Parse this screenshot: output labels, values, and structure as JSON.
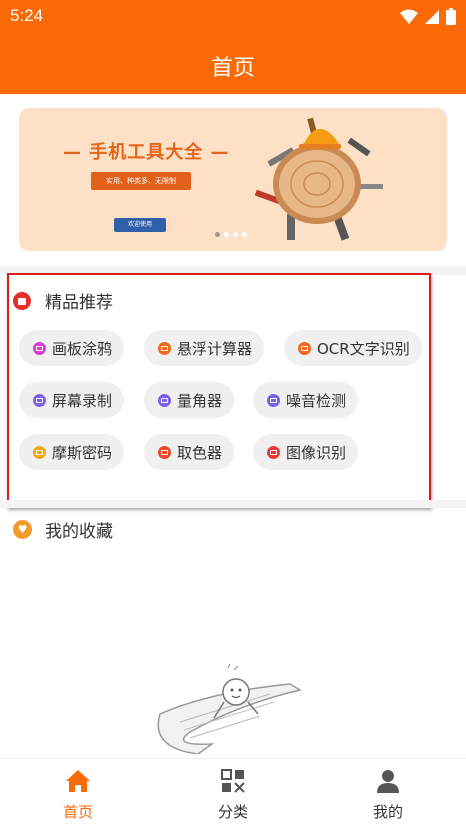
{
  "status_bar": {
    "time": "5:24"
  },
  "app_bar": {
    "title": "首页"
  },
  "banner": {
    "title": "— 手机工具大全 —",
    "subtitle": "实用、种类多、无限制",
    "button": "欢迎使用",
    "dots": 4,
    "active_dot": 0
  },
  "featured": {
    "title": "精品推荐",
    "items": [
      {
        "label": "画板涂鸦",
        "icon": "palette-icon",
        "color": "#d63fd6"
      },
      {
        "label": "悬浮计算器",
        "icon": "calculator-icon",
        "color": "#f06a1d"
      },
      {
        "label": "OCR文字识别",
        "icon": "ocr-icon",
        "color": "#f06a1d"
      },
      {
        "label": "屏幕录制",
        "icon": "screen-record-icon",
        "color": "#7b61e8"
      },
      {
        "label": "量角器",
        "icon": "protractor-icon",
        "color": "#7b61e8"
      },
      {
        "label": "噪音检测",
        "icon": "noise-icon",
        "color": "#7b61e8"
      },
      {
        "label": "摩斯密码",
        "icon": "morse-icon",
        "color": "#f3a81c"
      },
      {
        "label": "取色器",
        "icon": "color-picker-icon",
        "color": "#e84a2a"
      },
      {
        "label": "图像识别",
        "icon": "image-recognition-icon",
        "color": "#e83a3a"
      }
    ]
  },
  "favorites": {
    "title": "我的收藏"
  },
  "bottom_nav": [
    {
      "label": "首页",
      "icon": "home-icon",
      "active": true
    },
    {
      "label": "分类",
      "icon": "category-icon",
      "active": false
    },
    {
      "label": "我的",
      "icon": "profile-icon",
      "active": false
    }
  ],
  "colors": {
    "accent": "#fb6a07",
    "highlight_box": "#e01b1b"
  }
}
